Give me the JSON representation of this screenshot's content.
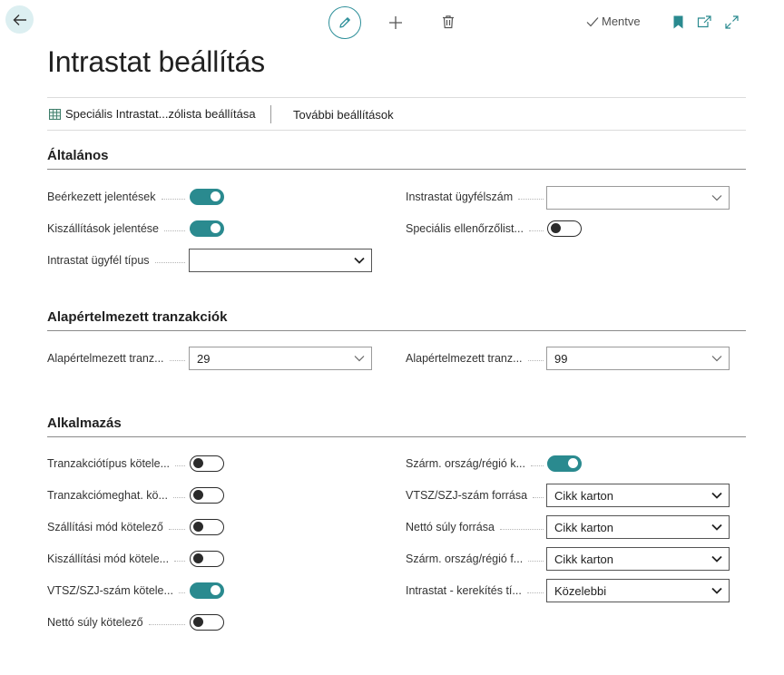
{
  "toolbar": {
    "saved_label": "Mentve"
  },
  "page": {
    "title": "Intrastat beállítás"
  },
  "actions": {
    "special_checklist": "Speciális Intrastat...zólista beállítása",
    "more_settings": "További beállítások"
  },
  "sections": {
    "general": {
      "title": "Általános",
      "received_reports": {
        "label": "Beérkezett jelentések",
        "on": true
      },
      "shipped_reports": {
        "label": "Kiszállítások jelentése",
        "on": true
      },
      "contact_type": {
        "label": "Intrastat ügyfél típus",
        "value": ""
      },
      "contact_no": {
        "label": "Instrastat ügyfélszám",
        "value": ""
      },
      "special_checklist": {
        "label": "Speciális ellenőrzőlist...",
        "on": false
      }
    },
    "default_transactions": {
      "title": "Alapértelmezett tranzakciók",
      "left": {
        "label": "Alapértelmezett tranz...",
        "value": "29"
      },
      "right": {
        "label": "Alapértelmezett tranz...",
        "value": "99"
      }
    },
    "application": {
      "title": "Alkalmazás",
      "left": [
        {
          "label": "Tranzakciótípus kötele...",
          "on": false
        },
        {
          "label": "Tranzakciómeghat. kö...",
          "on": false
        },
        {
          "label": "Szállítási mód kötelező",
          "on": false
        },
        {
          "label": "Kiszállítási mód kötele...",
          "on": false
        },
        {
          "label": "VTSZ/SZJ-szám kötele...",
          "on": true
        },
        {
          "label": "Nettó súly kötelező",
          "on": false
        }
      ],
      "country_origin_mandatory": {
        "label": "Szárm. ország/régió k...",
        "on": true
      },
      "tariff_source": {
        "label": "VTSZ/SZJ-szám forrása",
        "value": "Cikk karton"
      },
      "net_weight_source": {
        "label": "Nettó súly forrása",
        "value": "Cikk karton"
      },
      "country_origin_source": {
        "label": "Szárm. ország/régió f...",
        "value": "Cikk karton"
      },
      "rounding_type": {
        "label": "Intrastat - kerekítés tí...",
        "value": "Közelebbi"
      }
    }
  },
  "colors": {
    "accent": "#2a8a8f",
    "back_bg": "#dceff1"
  }
}
